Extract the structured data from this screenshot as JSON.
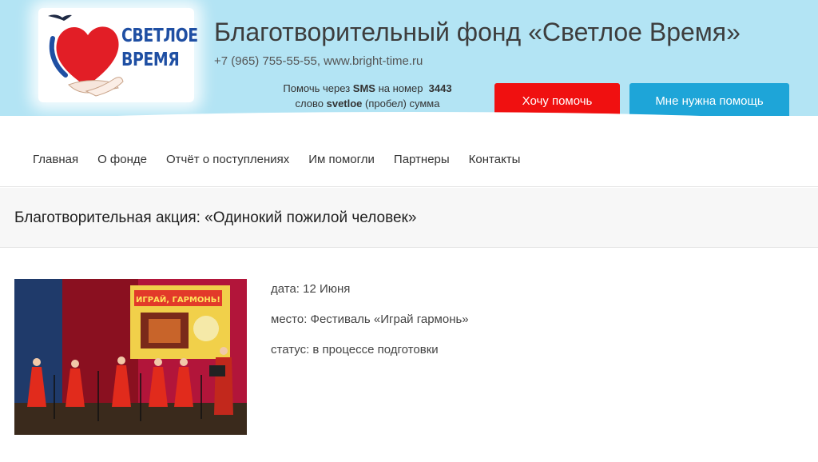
{
  "header": {
    "logo_text_line1": "СВЕТЛОЕ",
    "logo_text_line2": "ВРЕМЯ",
    "title": "Благотворительный фонд «Светлое Время»",
    "contacts": "+7 (965) 755-55-55, www.bright-time.ru",
    "sms_line1_prefix": "Помочь через",
    "sms_line1_sms": "SMS",
    "sms_line1_mid": "на номер",
    "sms_line1_number": "3443",
    "sms_line2_prefix": "слово",
    "sms_line2_word": "svetloe",
    "sms_line2_suffix": "(пробел) сумма",
    "help_button": "Хочу помочь",
    "need_help_button": "Мне нужна помощь"
  },
  "nav": {
    "items": [
      {
        "label": "Главная"
      },
      {
        "label": "О фонде"
      },
      {
        "label": "Отчёт о поступлениях"
      },
      {
        "label": "Им помогли"
      },
      {
        "label": "Партнеры"
      },
      {
        "label": "Контакты"
      }
    ]
  },
  "page": {
    "title": "Благотворительная акция: «Одинокий пожилой человек»"
  },
  "event": {
    "photo_banner": "ИГРАЙ, ГАРМОНЬ!",
    "date": "дата: 12 Июня",
    "place": "место: Фестиваль «Играй гармонь»",
    "status": "статус: в процессе подготовки"
  },
  "colors": {
    "header_bg": "#b3e4f4",
    "help_button": "#f01010",
    "need_help_button": "#1ea5d8",
    "logo_blue": "#1f4fa3",
    "logo_red": "#e21e26"
  }
}
